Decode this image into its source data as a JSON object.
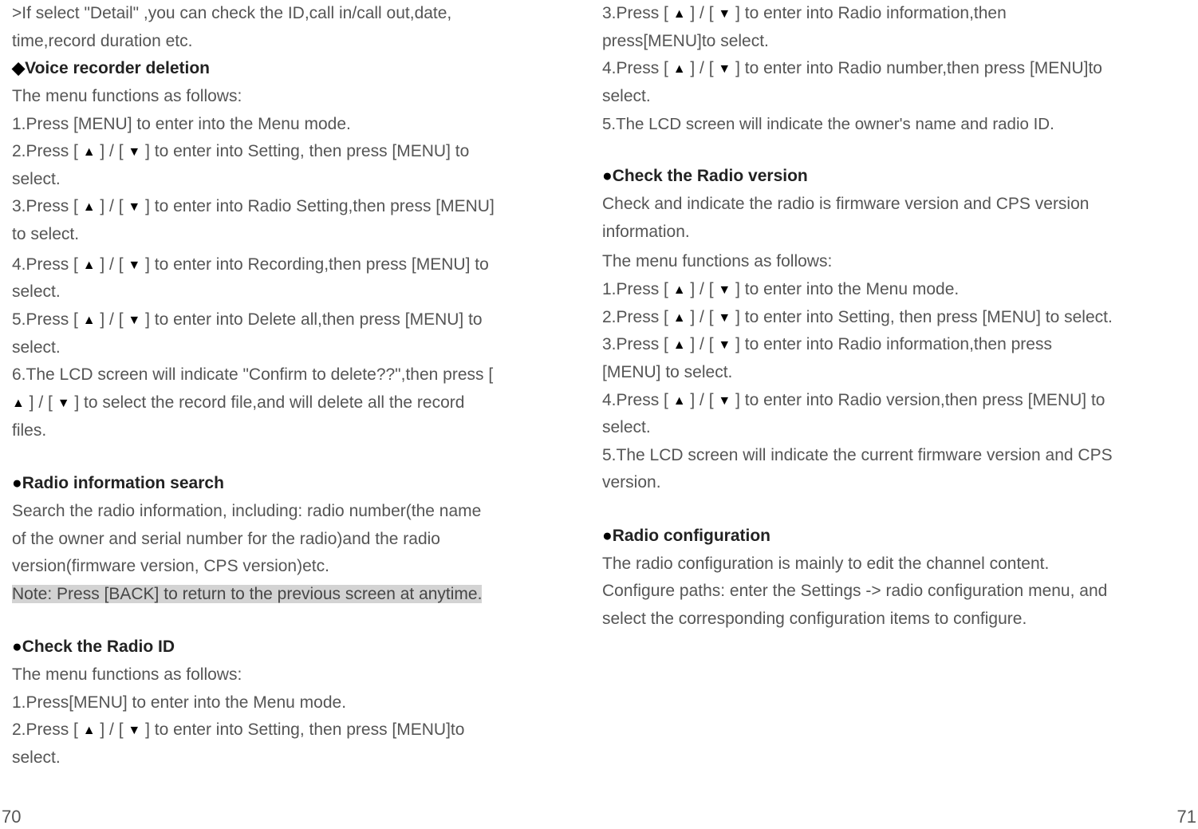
{
  "left": {
    "intro": ">If select  \"Detail\"  ,you can check the ID,call in/call out,date, time,record duration etc.",
    "h1_prefix": "◆",
    "h1": "Voice recorder deletion",
    "l1": "The menu functions as follows:",
    "l2": "1.Press [MENU] to enter into the Menu mode.",
    "l3a": "2.Press [ ",
    "l3b": " ] / [ ",
    "l3c": " ] to enter into Setting, then press [MENU] to select.",
    "l4a": "3.Press [ ",
    "l4b": " ] / [ ",
    "l4c": " ] to enter into Radio Setting,then press [MENU] to select.",
    "l5a": "4.Press [ ",
    "l5b": " ] / [ ",
    "l5c": " ] to enter into Recording,then press [MENU] to select.",
    "l6a": "5.Press [ ",
    "l6b": " ] / [ ",
    "l6c": " ] to enter into Delete all,then press [MENU] to select.",
    "l7a": "6.The LCD screen will indicate \"Confirm to delete??\",then press [ ",
    "l7b": " ] / [ ",
    "l7c": " ] to select the record file,and will delete all the record files.",
    "h2": "Radio information search",
    "p2": "Search the radio information, including: radio number(the name of the owner and serial number for the radio)and the radio version(firmware version, CPS version)etc.",
    "note": "Note: Press [BACK] to return to the previous screen at anytime.",
    "h3": "Check the Radio ID",
    "l8": "The menu functions as follows:",
    "l9": "1.Press[MENU] to enter into the Menu mode.",
    "l10a": "2.Press [ ",
    "l10b": " ] / [ ",
    "l10c": " ] to enter into Setting, then press [MENU]to select."
  },
  "right": {
    "r1a": "3.Press [ ",
    "r1b": " ] / [ ",
    "r1c": " ] to enter into Radio information,then press[MENU]to select.",
    "r2a": "4.Press [ ",
    "r2b": " ] / [ ",
    "r2c": " ] to enter into Radio number,then press [MENU]to select.",
    "r3": "5.The LCD screen will indicate the owner's name and radio ID.",
    "h4": "Check the Radio version",
    "p4": "Check and indicate the radio is firmware version and CPS version information.",
    "r4": "The menu functions as follows:",
    "r5a": "1.Press [ ",
    "r5b": " ] / [ ",
    "r5c": " ] to enter into the Menu mode.",
    "r6a": "2.Press [ ",
    "r6b": " ] / [ ",
    "r6c": " ] to enter into Setting, then press [MENU] to select.",
    "r7a": "3.Press [ ",
    "r7b": " ] / [ ",
    "r7c": " ] to enter into Radio information,then press [MENU] to select.",
    "r8a": "4.Press [ ",
    "r8b": " ] / [ ",
    "r8c": " ] to enter into Radio version,then press [MENU] to select.",
    "r9": "5.The LCD screen will indicate the current firmware version and CPS version.",
    "h5": "Radio configuration",
    "p5": "The radio configuration is mainly to edit the channel content. Configure paths: enter the Settings -> radio configuration menu, and select the corresponding configuration items to configure."
  },
  "pages": {
    "left": "70",
    "right": "71"
  },
  "icons": {
    "up": "▲",
    "down": "▼"
  }
}
